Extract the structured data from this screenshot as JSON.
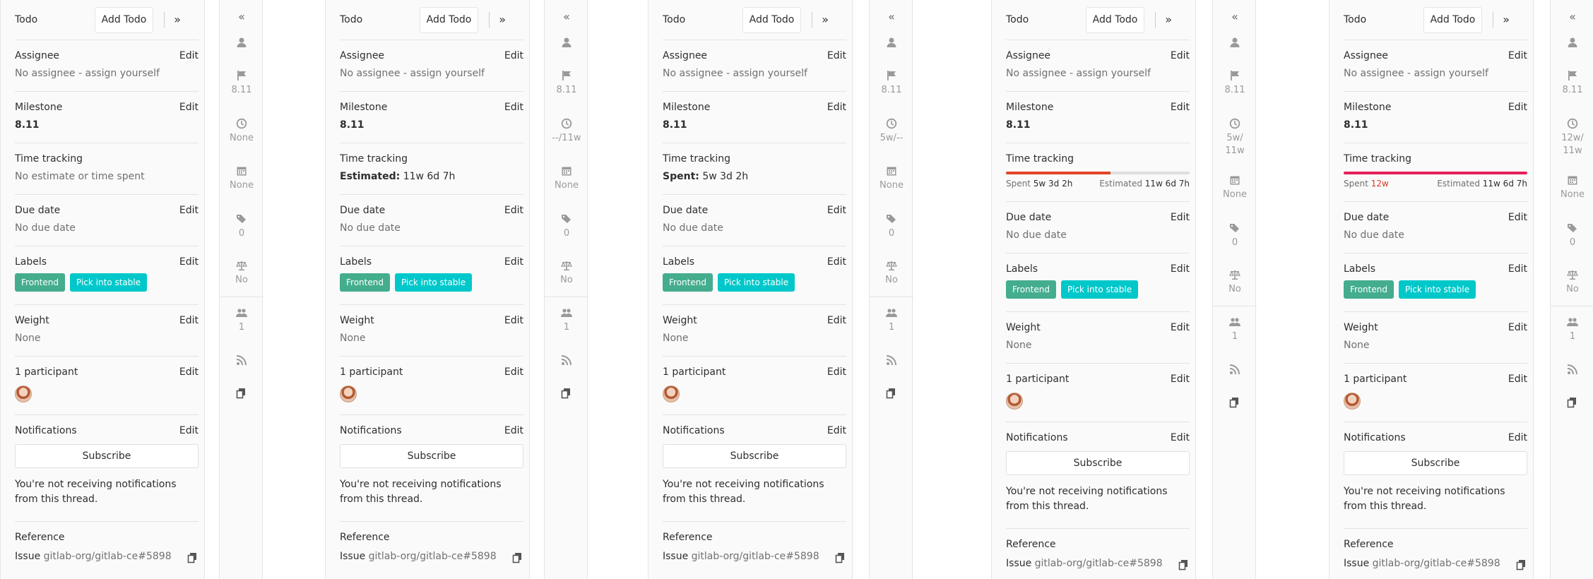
{
  "header": {
    "todo_label": "Todo",
    "add_todo_label": "Add Todo",
    "collapse_glyph": "»",
    "expand_glyph": "«"
  },
  "common": {
    "assignee_title": "Assignee",
    "assignee_value": "No assignee - assign yourself",
    "milestone_title": "Milestone",
    "milestone_value": "8.11",
    "time_tracking_title": "Time tracking",
    "due_date_title": "Due date",
    "due_date_value": "No due date",
    "labels_title": "Labels",
    "labels": [
      {
        "name": "Frontend",
        "color": "#44ad8e"
      },
      {
        "name": "Pick into stable",
        "color": "#00c8ca"
      }
    ],
    "weight_title": "Weight",
    "weight_value": "None",
    "participants_title": "1 participant",
    "notifications_title": "Notifications",
    "subscribe_label": "Subscribe",
    "notif_text": "You're not receiving notifications from this thread.",
    "reference_title": "Reference",
    "reference_prefix": "Issue",
    "reference_value": "gitlab-org/gitlab-ce#5898",
    "edit_label": "Edit"
  },
  "panels": [
    {
      "time_tracking": {
        "mode": "none",
        "text": "No estimate or time spent"
      }
    },
    {
      "time_tracking": {
        "mode": "estimated",
        "key": "Estimated:",
        "val": "11w 6d 7h"
      }
    },
    {
      "time_tracking": {
        "mode": "spent",
        "key": "Spent:",
        "val": "5w 3d 2h"
      }
    },
    {
      "time_tracking": {
        "mode": "bar",
        "spent_key": "Spent",
        "spent_val": "5w 3d 2h",
        "est_key": "Estimated",
        "est_val": "11w 6d 7h",
        "progress": 0.57,
        "bar_color": "#e24329",
        "over": false
      }
    },
    {
      "time_tracking": {
        "mode": "bar",
        "spent_key": "Spent",
        "spent_val": "12w",
        "est_key": "Estimated",
        "est_val": "11w 6d 7h",
        "progress": 1.0,
        "bar_color": "#e5205a",
        "over": true
      }
    }
  ],
  "rails": [
    {
      "time": "None",
      "due": "None",
      "labels_count": "0",
      "weight": "No",
      "participants": "1",
      "milestone": "8.11"
    },
    {
      "time": "--/11w",
      "due": "None",
      "labels_count": "0",
      "weight": "No",
      "participants": "1",
      "milestone": "8.11"
    },
    {
      "time": "5w/--",
      "due": "None",
      "labels_count": "0",
      "weight": "No",
      "participants": "1",
      "milestone": "8.11"
    },
    {
      "time": "5w/ 11w",
      "due": "None",
      "labels_count": "0",
      "weight": "No",
      "participants": "1",
      "milestone": "8.11"
    },
    {
      "time": "12w/ 11w",
      "due": "None",
      "labels_count": "0",
      "weight": "No",
      "participants": "1",
      "milestone": "8.11"
    }
  ]
}
